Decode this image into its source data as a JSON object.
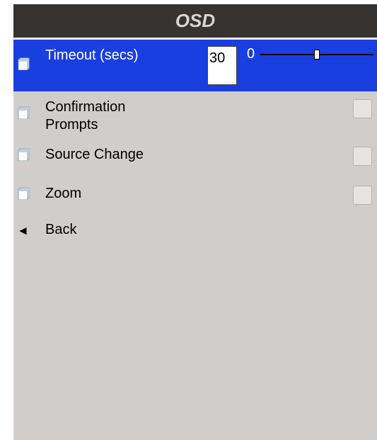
{
  "menu": {
    "title": "OSD",
    "items": [
      {
        "label": "Timeout (secs)",
        "value": "30",
        "slider_min_label": "0",
        "slider_level": 0.5,
        "selected": true
      },
      {
        "label": "Confirmation\nPrompts",
        "checked": false
      },
      {
        "label": "Source Change",
        "checked": false
      },
      {
        "label": "Zoom",
        "checked": false
      }
    ],
    "back": {
      "glyph": "◄",
      "label": "Back"
    }
  },
  "colors": {
    "title_bar": "#363330",
    "selected_row": "#1a3fe0",
    "panel_background": "#d1cdca"
  },
  "icons": {
    "item_icon": "page-icon",
    "back_icon": "left-triangle-icon"
  }
}
